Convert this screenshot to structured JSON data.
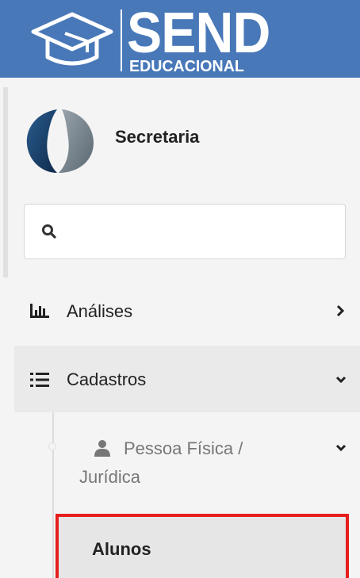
{
  "brand": {
    "title": "SEND",
    "subtitle": "EDUCACIONAL",
    "color": "#4878b8"
  },
  "profile": {
    "name": "Secretaria"
  },
  "search": {
    "placeholder": "",
    "value": ""
  },
  "menu": {
    "items": [
      {
        "label": "Análises",
        "icon": "bar-chart-icon",
        "chevron": "chevron-right-icon"
      },
      {
        "label": "Cadastros",
        "icon": "list-icon",
        "chevron": "chevron-down-icon"
      }
    ],
    "submenu": {
      "label_line1": "Pessoa Física /",
      "label_line2": "Jurídica",
      "icon": "user-icon",
      "chevron": "chevron-down-icon",
      "children": [
        {
          "label": "Alunos",
          "highlight_color": "#e61e1e"
        }
      ]
    }
  }
}
